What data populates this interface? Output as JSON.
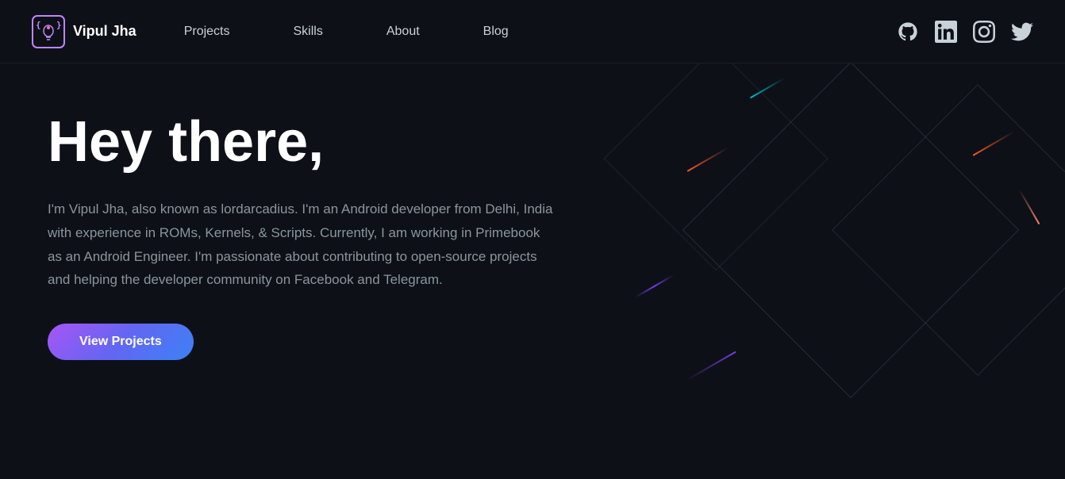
{
  "nav": {
    "logo_text": "Vipul Jha",
    "links": [
      {
        "label": "Projects",
        "href": "#projects"
      },
      {
        "label": "Skills",
        "href": "#skills"
      },
      {
        "label": "About",
        "href": "#about"
      },
      {
        "label": "Blog",
        "href": "#blog"
      }
    ],
    "social": [
      {
        "name": "github",
        "title": "GitHub"
      },
      {
        "name": "linkedin",
        "title": "LinkedIn"
      },
      {
        "name": "instagram",
        "title": "Instagram"
      },
      {
        "name": "twitter",
        "title": "Twitter"
      }
    ]
  },
  "hero": {
    "title": "Hey there,",
    "description": "I'm Vipul Jha, also known as lordarcadius. I'm an Android developer from Delhi, India with experience in ROMs, Kernels, & Scripts. Currently, I am working in Primebook as an Android Engineer. I'm passionate about contributing to open-source projects and helping the developer community on Facebook and Telegram.",
    "cta_label": "View Projects"
  }
}
